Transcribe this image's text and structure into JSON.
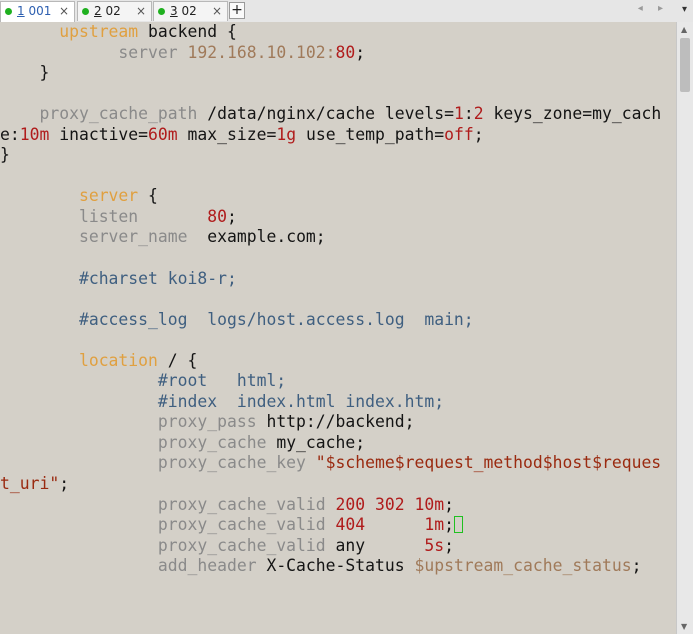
{
  "tabs": [
    {
      "number": "1",
      "title": "001",
      "active": true,
      "modified": true
    },
    {
      "number": "2",
      "title": "02",
      "active": false,
      "modified": true
    },
    {
      "number": "3",
      "title": "02",
      "active": false,
      "modified": true
    }
  ],
  "tab_close_glyph": "×",
  "new_tab_glyph": "+",
  "nav_arrows": "◂ ▸",
  "menu_arrow": "▾",
  "colors": {
    "keyword": "#e0a040",
    "directive": "#8a8a8a",
    "comment": "#3f5f80",
    "number": "#b01c1c",
    "string": "#9a2a10",
    "variable": "#a07a5a",
    "cursor": "#20c020",
    "background": "#d4d0c8"
  },
  "editor": {
    "lines": [
      [
        {
          "t": "      "
        },
        {
          "t": "upstream",
          "c": "kw"
        },
        {
          "t": " backend {"
        }
      ],
      [
        {
          "t": "            "
        },
        {
          "t": "server",
          "c": "dir"
        },
        {
          "t": " 192.168.10.102:",
          "c": "var"
        },
        {
          "t": "80",
          "c": "num"
        },
        {
          "t": ";"
        }
      ],
      [
        {
          "t": "    }"
        }
      ],
      [
        {
          "t": ""
        }
      ],
      [
        {
          "t": "    "
        },
        {
          "t": "proxy_cache_path",
          "c": "dir"
        },
        {
          "t": " /data/nginx/cache levels="
        },
        {
          "t": "1",
          "c": "num"
        },
        {
          "t": ":"
        },
        {
          "t": "2",
          "c": "num"
        },
        {
          "t": " keys_zone=my_cach"
        }
      ],
      [
        {
          "t": "e:"
        },
        {
          "t": "10m",
          "c": "num"
        },
        {
          "t": " inactive="
        },
        {
          "t": "60m",
          "c": "num"
        },
        {
          "t": " max_size="
        },
        {
          "t": "1g",
          "c": "num"
        },
        {
          "t": " use_temp_path="
        },
        {
          "t": "off",
          "c": "num"
        },
        {
          "t": ";"
        }
      ],
      [
        {
          "t": "}"
        }
      ],
      [
        {
          "t": ""
        }
      ],
      [
        {
          "t": "        "
        },
        {
          "t": "server",
          "c": "kw"
        },
        {
          "t": " {"
        }
      ],
      [
        {
          "t": "        "
        },
        {
          "t": "listen",
          "c": "dir"
        },
        {
          "t": "       "
        },
        {
          "t": "80",
          "c": "num"
        },
        {
          "t": ";"
        }
      ],
      [
        {
          "t": "        "
        },
        {
          "t": "server_name",
          "c": "dir"
        },
        {
          "t": "  example.com;"
        }
      ],
      [
        {
          "t": ""
        }
      ],
      [
        {
          "t": "        "
        },
        {
          "t": "#charset koi8-r;",
          "c": "cm"
        }
      ],
      [
        {
          "t": ""
        }
      ],
      [
        {
          "t": "        "
        },
        {
          "t": "#access_log  logs/host.access.log  main;",
          "c": "cm"
        }
      ],
      [
        {
          "t": ""
        }
      ],
      [
        {
          "t": "        "
        },
        {
          "t": "location",
          "c": "kw"
        },
        {
          "t": " / {"
        }
      ],
      [
        {
          "t": "                "
        },
        {
          "t": "#root   html;",
          "c": "cm"
        }
      ],
      [
        {
          "t": "                "
        },
        {
          "t": "#index  index.html index.htm;",
          "c": "cm"
        }
      ],
      [
        {
          "t": "                "
        },
        {
          "t": "proxy_pass",
          "c": "dir"
        },
        {
          "t": " http://backend;"
        }
      ],
      [
        {
          "t": "                "
        },
        {
          "t": "proxy_cache",
          "c": "dir"
        },
        {
          "t": " my_cache;"
        }
      ],
      [
        {
          "t": "                "
        },
        {
          "t": "proxy_cache_key",
          "c": "dir"
        },
        {
          "t": " "
        },
        {
          "t": "\"$scheme$request_method$host$reques",
          "c": "str"
        }
      ],
      [
        {
          "t": "t_uri\"",
          "c": "str"
        },
        {
          "t": ";"
        }
      ],
      [
        {
          "t": "                "
        },
        {
          "t": "proxy_cache_valid",
          "c": "dir"
        },
        {
          "t": " "
        },
        {
          "t": "200 302 10m",
          "c": "num"
        },
        {
          "t": ";"
        }
      ],
      [
        {
          "t": "                "
        },
        {
          "t": "proxy_cache_valid",
          "c": "dir"
        },
        {
          "t": " "
        },
        {
          "t": "404",
          "c": "num"
        },
        {
          "t": "      "
        },
        {
          "t": "1m",
          "c": "num"
        },
        {
          "t": ";"
        },
        {
          "cursor": true
        }
      ],
      [
        {
          "t": "                "
        },
        {
          "t": "proxy_cache_valid",
          "c": "dir"
        },
        {
          "t": " any      "
        },
        {
          "t": "5s",
          "c": "num"
        },
        {
          "t": ";"
        }
      ],
      [
        {
          "t": "                "
        },
        {
          "t": "add_header",
          "c": "dir"
        },
        {
          "t": " X-Cache-Status "
        },
        {
          "t": "$upstream_cache_status",
          "c": "var"
        },
        {
          "t": ";"
        }
      ]
    ]
  }
}
